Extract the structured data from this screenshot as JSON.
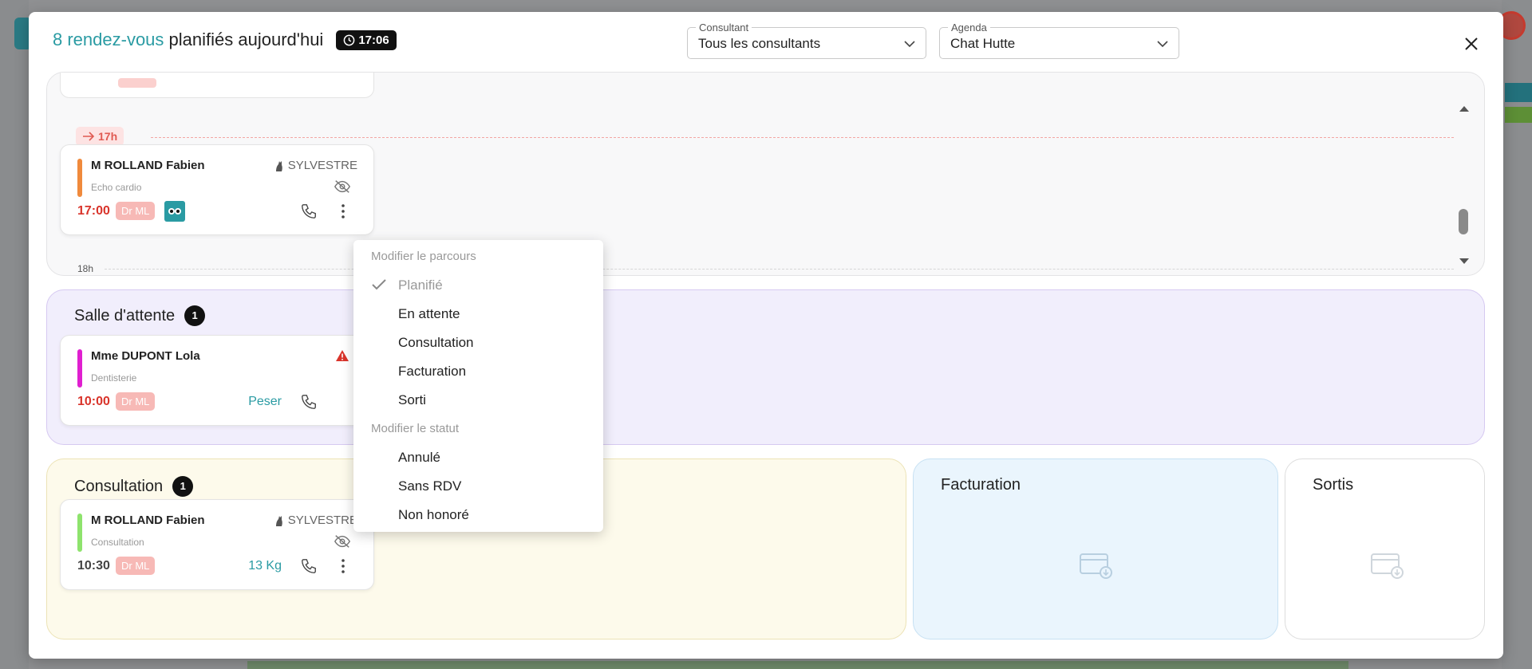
{
  "header": {
    "count_text": "8 rendez-vous",
    "rest_text": " planifiés aujourd'hui",
    "time": "17:06"
  },
  "filters": {
    "consultant_label": "Consultant",
    "consultant_value": "Tous les consultants",
    "agenda_label": "Agenda",
    "agenda_value": "Chat Hutte"
  },
  "timeline": {
    "marker_17": "17h",
    "label_18": "18h",
    "card": {
      "name": "M ROLLAND Fabien",
      "owner": "SYLVESTRE",
      "type": "Echo cardio",
      "time": "17:00",
      "doctor": "Dr ML"
    }
  },
  "attente": {
    "title": "Salle d'attente",
    "count": "1",
    "card": {
      "name": "Mme DUPONT Lola",
      "type": "Dentisterie",
      "time": "10:00",
      "doctor": "Dr ML",
      "action": "Peser"
    }
  },
  "consultation": {
    "title": "Consultation",
    "count": "1",
    "card": {
      "name": "M ROLLAND Fabien",
      "owner": "SYLVESTRE",
      "type": "Consultation",
      "time": "10:30",
      "doctor": "Dr ML",
      "weight": "13 Kg"
    }
  },
  "facturation": {
    "title": "Facturation"
  },
  "sortis": {
    "title": "Sortis"
  },
  "menu": {
    "section_parcours": "Modifier le parcours",
    "parcours": [
      "Planifié",
      "En attente",
      "Consultation",
      "Facturation",
      "Sorti"
    ],
    "section_statut": "Modifier le statut",
    "statut": [
      "Annulé",
      "Sans RDV",
      "Non honoré"
    ]
  },
  "colors": {
    "accent": "#2a9ba3",
    "bar_orange": "#f08a3c",
    "bar_magenta": "#e01fd0",
    "bar_green": "#8ee36d",
    "time_red": "#d9342b",
    "badge_pink": "#f7b9b6"
  },
  "icons": [
    "clock-icon",
    "chevron-down-icon",
    "close-icon",
    "cat-icon",
    "dog-icon",
    "eye-off-icon",
    "phone-icon",
    "more-vertical-icon",
    "warning-icon",
    "arrow-right-icon",
    "check-icon",
    "drop-zone-icon"
  ]
}
